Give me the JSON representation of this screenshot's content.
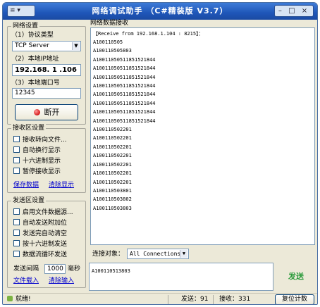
{
  "window": {
    "title": "网络调试助手 （C#精装版 V3.7）",
    "sys_menu": "≌ ▾",
    "controls": "– □ ×"
  },
  "network": {
    "group_title": "网络设置",
    "protocol_label": "（1）协议类型",
    "protocol_value": "TCP Server",
    "ip_label": "（2）本地IP地址",
    "ip_value": "192.168. 1 .106",
    "port_label": "（3）本地端口号",
    "port_value": "12345",
    "disconnect_label": "断开"
  },
  "receive_settings": {
    "group_title": "接收区设置",
    "options": [
      "接收转向文件...",
      "自动换行显示",
      "十六进制显示",
      "暂停接收显示"
    ],
    "save_link": "保存数据",
    "clear_link": "清除显示"
  },
  "send_settings": {
    "group_title": "发送区设置",
    "options": [
      "启用文件数据源...",
      "自动发送附加位",
      "发送完自动清空",
      "按十六进制发送",
      "数据流循环发送"
    ],
    "interval_label": "发送间隔",
    "interval_value": "1000",
    "interval_unit": "毫秒",
    "load_file_link": "文件载入",
    "clear_input_link": "清除输入"
  },
  "receive_area": {
    "group_title": "网络数据接收",
    "header": "【Receive from 192.168.1.104 : 8215】：",
    "lines": [
      "A100110505",
      "A100110505803",
      "A10011050511851521844",
      "A10011050511851521844",
      "A10011050511851521844",
      "A10011050511851521844",
      "A10011050511851521844",
      "A10011050511851521844",
      "A10011050511851521844",
      "A10011050511851521844",
      "A100110502201",
      "A100110502201",
      "A100110502201",
      "A100110502201",
      "A100110502201",
      "A100110502201",
      "A100110502201",
      "A100110503801",
      "A100110503802",
      "A100110503803"
    ]
  },
  "connection": {
    "label": "连接对象：",
    "value": "All Connections"
  },
  "send_area": {
    "text": "A100110513803",
    "send_button": "发送"
  },
  "status": {
    "ready": "就绪!",
    "send_count": "发送：91",
    "recv_count": "接收：331",
    "reset_button": "复位计数"
  },
  "colors": {
    "title_bar": "#1f56b8",
    "send_button_text": "#2a9a3a",
    "link": "#0000cc",
    "indicator": "#d41818"
  }
}
